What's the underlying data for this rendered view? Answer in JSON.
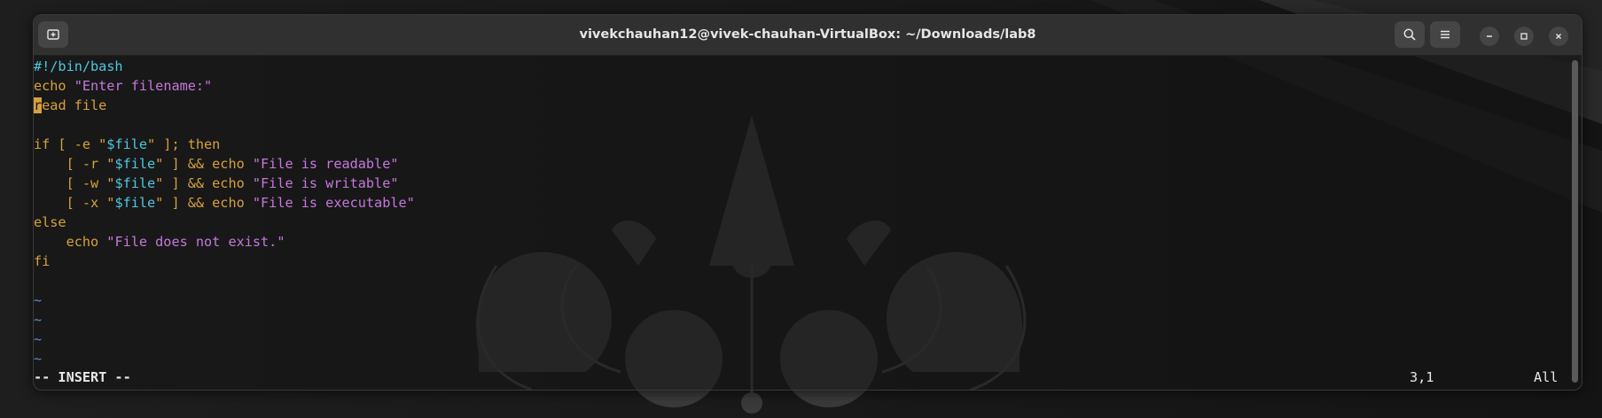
{
  "window": {
    "title": "vivekchauhan12@vivek-chauhan-VirtualBox: ~/Downloads/lab8",
    "buttons": [
      "new-tab-icon",
      "search-icon",
      "menu-icon",
      "minimize-icon",
      "maximize-icon",
      "close-icon"
    ]
  },
  "editor": {
    "shebang": "#!/bin/bash",
    "l2_cmd": "echo",
    "l2_str": "\"Enter filename:\"",
    "l3_cursor": "r",
    "l3_rest": "ead file",
    "l5_a": "if [ -e \"",
    "l5_var": "$file",
    "l5_b": "\" ]; then",
    "l6_a": "    [ -r \"",
    "l6_var": "$file",
    "l6_b": "\" ] && echo ",
    "l6_str": "\"File is readable\"",
    "l7_a": "    [ -w \"",
    "l7_var": "$file",
    "l7_b": "\" ] && echo ",
    "l7_str": "\"File is writable\"",
    "l8_a": "    [ -x \"",
    "l8_var": "$file",
    "l8_b": "\" ] && echo ",
    "l8_str": "\"File is executable\"",
    "l9": "else",
    "l10_a": "    echo ",
    "l10_str": "\"File does not exist.\"",
    "l11": "fi",
    "tilde": "~"
  },
  "status": {
    "mode": "-- INSERT --",
    "position": "3,1",
    "scroll": "All"
  },
  "colors": {
    "keyword": "#d7a13e",
    "string": "#c678dd",
    "variable": "#4fc7e0",
    "tilde": "#5b8fd6"
  }
}
